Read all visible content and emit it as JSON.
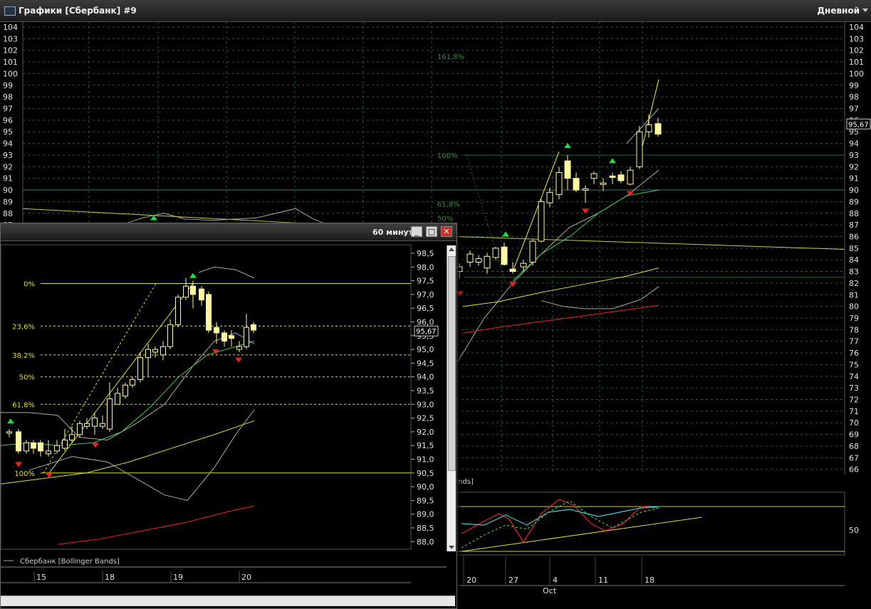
{
  "window": {
    "title": "Графики [Сбербанк] #9",
    "period": "Дневной"
  },
  "main_chart": {
    "y_ticks": [
      104,
      103,
      102,
      101,
      100,
      99,
      98,
      97,
      96,
      95,
      94,
      93,
      92,
      91,
      90,
      89,
      88,
      87,
      86,
      85,
      84,
      83,
      82,
      81,
      80,
      79,
      78,
      77,
      76,
      75,
      74,
      73,
      72,
      71,
      70,
      69,
      68,
      67,
      66
    ],
    "price_label": "95,67",
    "fib_labels": [
      "161,8%",
      "100%",
      "61,8%",
      "50%"
    ],
    "x_labels": [
      "20",
      "27",
      "4",
      "11",
      "18"
    ],
    "month_label": "Oct",
    "legend_fragment": "nds]",
    "osc_tick": "50",
    "colors": {
      "candle": "#fff8a0",
      "up_signal": "#22dd44",
      "down_signal": "#ee2222",
      "grid": "#1f5a4a"
    }
  },
  "sub_window": {
    "title": "60 минут",
    "buttons": {
      "minimize": "_",
      "maximize": "□",
      "close": "✕"
    },
    "y_ticks": [
      "98,5",
      "98,0",
      "97,5",
      "97,0",
      "96,5",
      "96,0",
      "95,5",
      "95,0",
      "94,5",
      "94,0",
      "93,5",
      "93,0",
      "92,5",
      "92,0",
      "91,5",
      "91,0",
      "90,5",
      "90,0",
      "89,5",
      "89,0",
      "88,5",
      "88,0"
    ],
    "price_label": "95,67",
    "fib_labels": [
      "0%",
      "23,6%",
      "38,2%",
      "50%",
      "61,8%",
      "100%"
    ],
    "legend": "Сбербанк [Bollinger Bands]",
    "x_labels": [
      "15",
      "18",
      "19",
      "20"
    ]
  }
}
